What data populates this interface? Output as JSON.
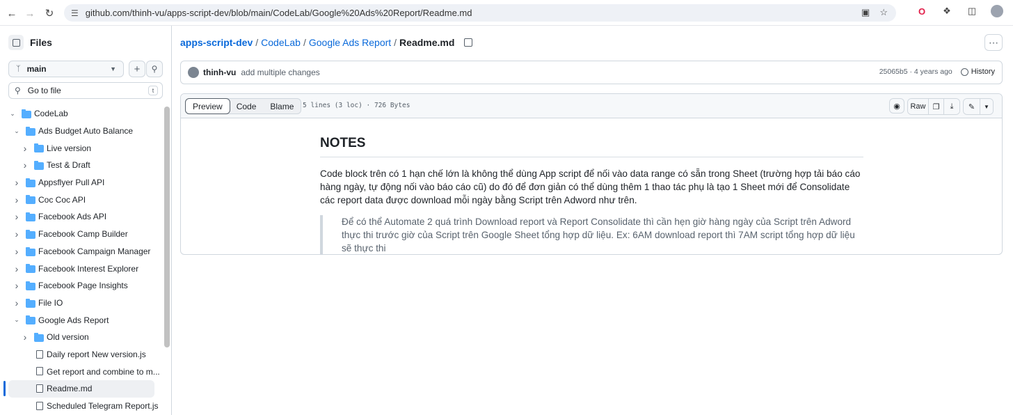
{
  "browser": {
    "url": "github.com/thinh-vu/apps-script-dev/blob/main/CodeLab/Google%20Ads%20Report/Readme.md"
  },
  "sidebar": {
    "title": "Files",
    "branch": "main",
    "goto_placeholder": "Go to file",
    "goto_shortcut": "t",
    "tree": [
      {
        "label": "CodeLab",
        "type": "folder",
        "depth": 0,
        "expanded": true
      },
      {
        "label": "Ads Budget Auto Balance",
        "type": "folder",
        "depth": 1,
        "expanded": true
      },
      {
        "label": "Live version",
        "type": "folder",
        "depth": 2,
        "expanded": false
      },
      {
        "label": "Test & Draft",
        "type": "folder",
        "depth": 2,
        "expanded": false
      },
      {
        "label": "Appsflyer Pull API",
        "type": "folder",
        "depth": 1,
        "expanded": false
      },
      {
        "label": "Coc Coc API",
        "type": "folder",
        "depth": 1,
        "expanded": false
      },
      {
        "label": "Facebook Ads API",
        "type": "folder",
        "depth": 1,
        "expanded": false
      },
      {
        "label": "Facebook Camp Builder",
        "type": "folder",
        "depth": 1,
        "expanded": false
      },
      {
        "label": "Facebook Campaign Manager",
        "type": "folder",
        "depth": 1,
        "expanded": false
      },
      {
        "label": "Facebook Interest Explorer",
        "type": "folder",
        "depth": 1,
        "expanded": false
      },
      {
        "label": "Facebook Page Insights",
        "type": "folder",
        "depth": 1,
        "expanded": false
      },
      {
        "label": "File IO",
        "type": "folder",
        "depth": 1,
        "expanded": false
      },
      {
        "label": "Google Ads Report",
        "type": "folder",
        "depth": 1,
        "expanded": true
      },
      {
        "label": "Old version",
        "type": "folder",
        "depth": 2,
        "expanded": false
      },
      {
        "label": "Daily report New version.js",
        "type": "file",
        "depth": 2
      },
      {
        "label": "Get report and combine to m...",
        "type": "file",
        "depth": 2
      },
      {
        "label": "Readme.md",
        "type": "file",
        "depth": 2,
        "active": true
      },
      {
        "label": "Scheduled Telegram Report.js",
        "type": "file",
        "depth": 2
      }
    ]
  },
  "breadcrumb": {
    "repo": "apps-script-dev",
    "folder1": "CodeLab",
    "folder2": "Google Ads Report",
    "file": "Readme.md",
    "sep": "/"
  },
  "commit": {
    "author": "thinh-vu",
    "message": "add multiple changes",
    "sha": "25065b5",
    "age": "4 years ago",
    "sha_age": "25065b5 · 4 years ago",
    "history_label": "History"
  },
  "file_header": {
    "tabs": [
      "Preview",
      "Code",
      "Blame"
    ],
    "meta": "5 lines (3 loc) · 726 Bytes",
    "raw_label": "Raw"
  },
  "readme": {
    "heading": "NOTES",
    "paragraph": "Code block trên có 1 hạn chế lớn là không thể dùng App script để nối vào data range có sẵn trong Sheet (trường hợp tải báo cáo hàng ngày, tự động nối vào báo cáo cũ) do đó để đơn giản có thể dùng thêm 1 thao tác phụ là tạo 1 Sheet mới để Consolidate các report data được download mỗi ngày bằng Script trên Adword như trên.",
    "quote": "Để có thể Automate 2 quá trình Download report và Report Consolidate thì cần hẹn giờ hàng ngày của Script trên Adword thực thi trước giờ của Script trên Google Sheet tổng hợp dữ liệu. Ex: 6AM download report thì 7AM script tổng hợp dữ liệu sẽ thực thi"
  },
  "colors": {
    "link": "#0969da",
    "folder": "#54aeff",
    "border": "#d0d7de"
  }
}
